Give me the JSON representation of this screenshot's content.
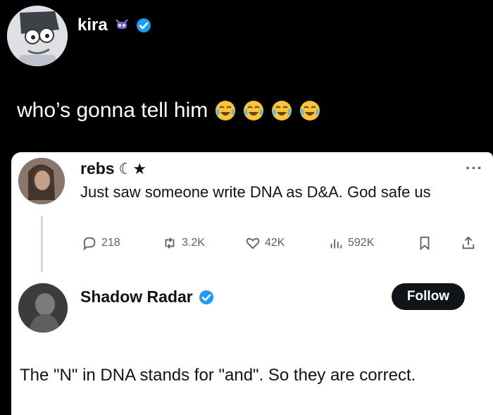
{
  "top_post": {
    "author": "kira",
    "text": "who’s gonna tell him",
    "emoji_icon": "crying-laughing-emoji",
    "emoji_count": 4,
    "verified_color": "#1d9bf0"
  },
  "quoted_post": {
    "author": "rebs",
    "author_suffix": "☾★",
    "more_label": "···",
    "text": "Just saw someone write DNA as D&A. God safe us",
    "stats": {
      "replies": "218",
      "reposts": "3.2K",
      "likes": "42K",
      "views": "592K"
    }
  },
  "reply_post": {
    "author": "Shadow Radar",
    "follow_label": "Follow",
    "text": "The \"N\" in DNA stands for \"and\". So they are correct."
  },
  "colors": {
    "background": "#000000",
    "card": "#ffffff",
    "text_dark": "#0f1419",
    "text_muted": "#536471",
    "accent": "#1d9bf0"
  }
}
